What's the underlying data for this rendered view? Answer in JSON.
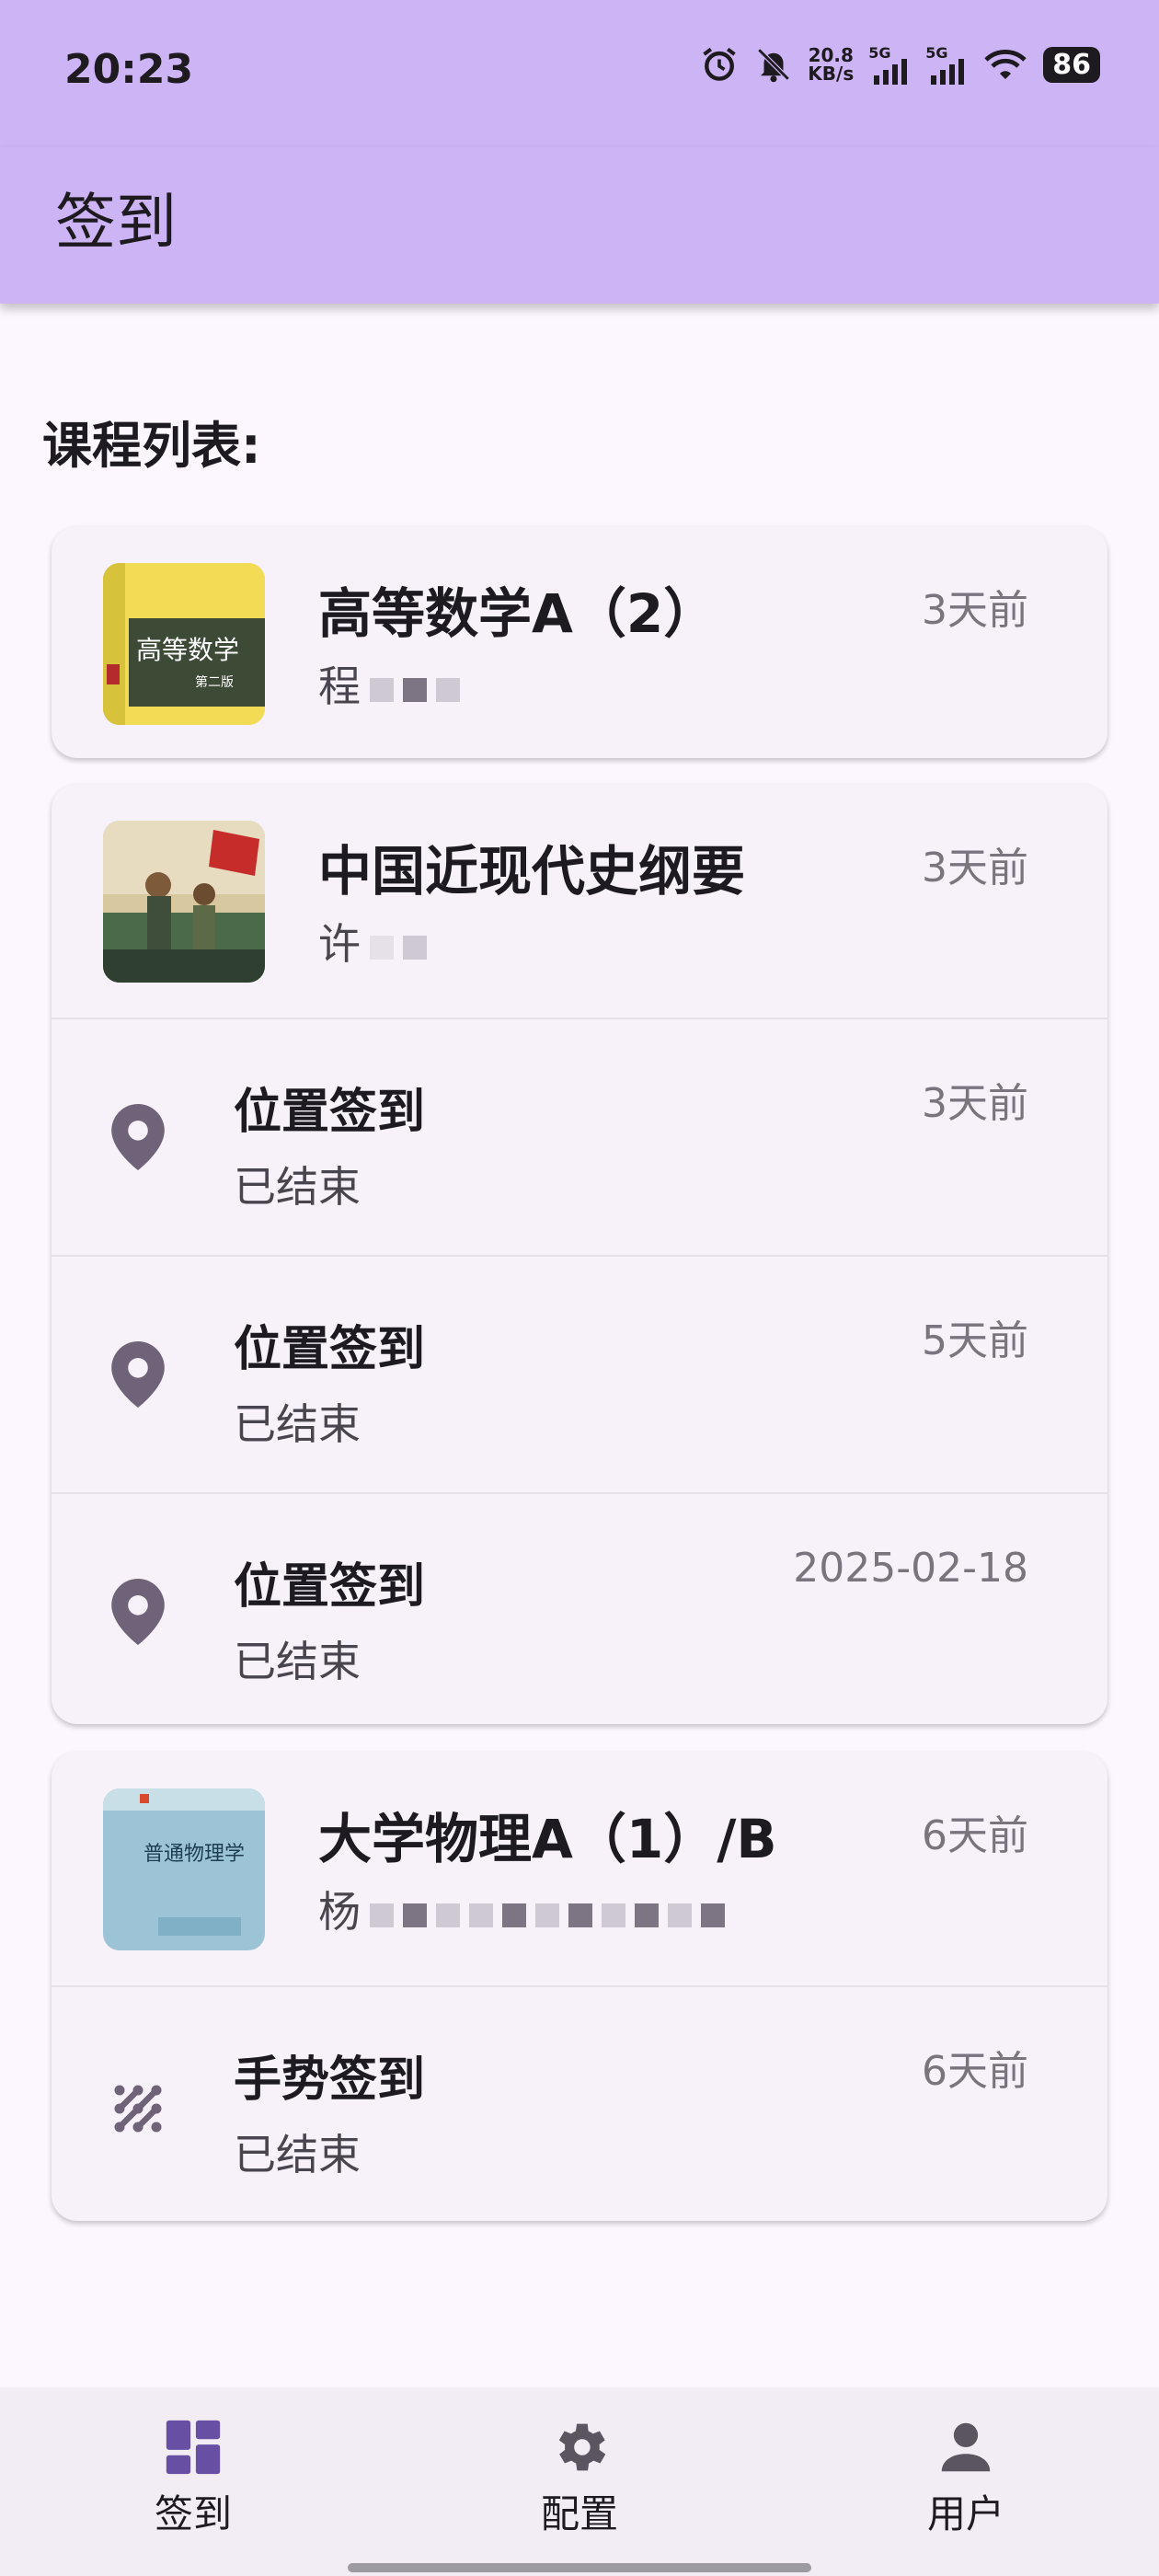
{
  "status_bar": {
    "time": "20:23",
    "net_speed": "20.8",
    "net_unit": "KB/s",
    "sig1": "5G",
    "sig2": "5G",
    "battery": "86"
  },
  "app_bar": {
    "title": "签到"
  },
  "section_label": "课程列表:",
  "courses": [
    {
      "name": "高等数学A（2）",
      "teacher": "程",
      "time": "3天前",
      "cover_text": "高等数学",
      "cover_sub": "第二版",
      "thumb_icon": "math-book-cover"
    },
    {
      "name": "中国近现代史纲要",
      "teacher": "许",
      "time": "3天前",
      "thumb_icon": "history-painting-cover",
      "checkins": [
        {
          "type": "位置签到",
          "status": "已结束",
          "time": "3天前",
          "icon": "location-pin-icon"
        },
        {
          "type": "位置签到",
          "status": "已结束",
          "time": "5天前",
          "icon": "location-pin-icon"
        },
        {
          "type": "位置签到",
          "status": "已结束",
          "time": "2025-02-18",
          "icon": "location-pin-icon"
        }
      ]
    },
    {
      "name": "大学物理A（1）/B",
      "teacher": "杨",
      "time": "6天前",
      "cover_text": "普通物理学",
      "thumb_icon": "physics-book-cover",
      "checkins": [
        {
          "type": "手势签到",
          "status": "已结束",
          "time": "6天前",
          "icon": "gesture-pattern-icon"
        }
      ]
    }
  ],
  "bottom_nav": [
    {
      "label": "签到",
      "icon": "dashboard-icon",
      "active": true
    },
    {
      "label": "配置",
      "icon": "gear-icon",
      "active": false
    },
    {
      "label": "用户",
      "icon": "person-icon",
      "active": false
    }
  ],
  "colors": {
    "accent": "#CDB4F4",
    "card": "#F7F1F9",
    "icon": "#6E6378",
    "nav_active": "#6750A4"
  }
}
